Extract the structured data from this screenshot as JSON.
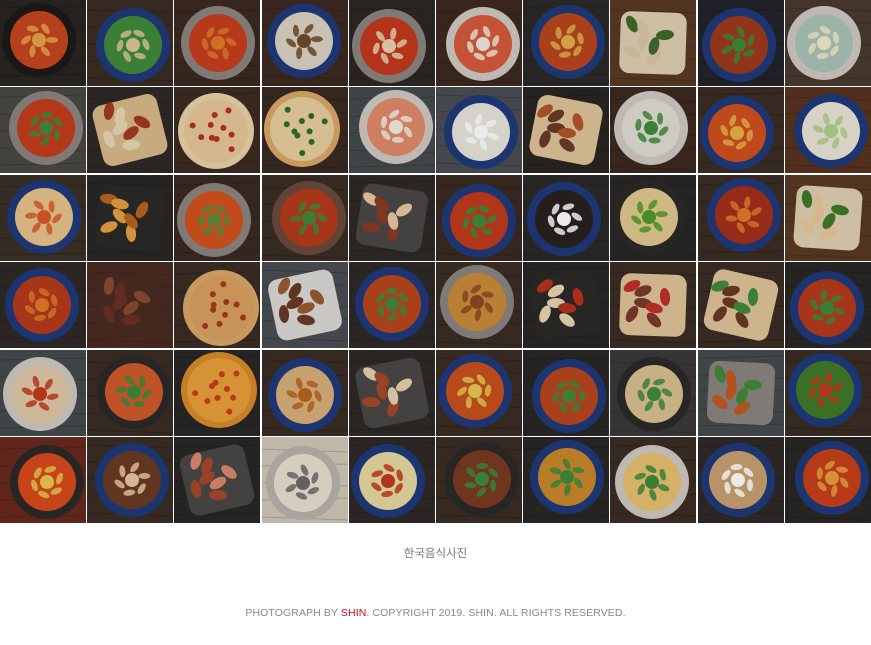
{
  "gallery": {
    "columns": 10,
    "rows": 6,
    "tiles": [
      {
        "bg": "#2a2522",
        "plate": "#1d1b1a",
        "food": "#c7461f",
        "accent": "#e8a34a",
        "shape": "bowl"
      },
      {
        "bg": "#3a2d24",
        "plate": "#1f3a7a",
        "food": "#3f8a3a",
        "accent": "#d9c69b",
        "shape": "bowl"
      },
      {
        "bg": "#3b2a20",
        "plate": "#8a8580",
        "food": "#c63e1e",
        "accent": "#e07a2a",
        "shape": "bowl"
      },
      {
        "bg": "#3d2b22",
        "plate": "#1f3a7a",
        "food": "#d9d2c4",
        "accent": "#6b4a2a",
        "shape": "bowl"
      },
      {
        "bg": "#2e2824",
        "plate": "#8a8580",
        "food": "#c4381e",
        "accent": "#e7d3b0",
        "shape": "bowl"
      },
      {
        "bg": "#3d2a20",
        "plate": "#cfc9c2",
        "food": "#d55a3c",
        "accent": "#f0e8dc",
        "shape": "bowl"
      },
      {
        "bg": "#2c2a28",
        "plate": "#1f3a7a",
        "food": "#b8461e",
        "accent": "#e3b04a",
        "shape": "bowl"
      },
      {
        "bg": "#5a3a24",
        "plate": "#e0cfb2",
        "food": "#d8c7a4",
        "accent": "#3f6b2a",
        "shape": "flat"
      },
      {
        "bg": "#23242a",
        "plate": "#1f3a7a",
        "food": "#9e3a1c",
        "accent": "#3f8a3a",
        "shape": "bowl"
      },
      {
        "bg": "#4a3a30",
        "plate": "#cfc9c2",
        "food": "#a9c4b6",
        "accent": "#f4e9c8",
        "shape": "bowl"
      },
      {
        "bg": "#4a4844",
        "plate": "#8a8580",
        "food": "#c53c1c",
        "accent": "#3f8a3a",
        "shape": "bowl"
      },
      {
        "bg": "#2f2a26",
        "plate": "#d9b98a",
        "food": "#e8d7b5",
        "accent": "#a23a1e",
        "shape": "flat"
      },
      {
        "bg": "#3d2b22",
        "plate": "#e8d2a8",
        "food": "#e7c79a",
        "accent": "#b8321c",
        "shape": "pizza"
      },
      {
        "bg": "#3a2a22",
        "plate": "#d9a868",
        "food": "#e9cf9e",
        "accent": "#2f6e2a",
        "shape": "pizza"
      },
      {
        "bg": "#454a4e",
        "plate": "#cfc9c2",
        "food": "#e08a6a",
        "accent": "#f1ebe3",
        "shape": "bowl"
      },
      {
        "bg": "#4a4e52",
        "plate": "#1f3a7a",
        "food": "#e8e4dc",
        "accent": "#ffffff",
        "shape": "bowl"
      },
      {
        "bg": "#2a2522",
        "plate": "#e0c49a",
        "food": "#6a3a26",
        "accent": "#b0562a",
        "shape": "flat"
      },
      {
        "bg": "#3d2a20",
        "plate": "#cfc9c2",
        "food": "#e0ddd4",
        "accent": "#3f8a3a",
        "shape": "bowl"
      },
      {
        "bg": "#3a2d24",
        "plate": "#1f3a7a",
        "food": "#d0501e",
        "accent": "#e7b04a",
        "shape": "bowl"
      },
      {
        "bg": "#5a3220",
        "plate": "#1f3a7a",
        "food": "#e9e4d6",
        "accent": "#b0d08a",
        "shape": "bowl"
      },
      {
        "bg": "#3a3028",
        "plate": "#1f3a7a",
        "food": "#e8c38a",
        "accent": "#d65a2a",
        "shape": "bowl"
      },
      {
        "bg": "#2a2826",
        "plate": "#2b2a28",
        "food": "#e3a040",
        "accent": "#b8641e",
        "shape": "flat"
      },
      {
        "bg": "#3a2a22",
        "plate": "#8a8580",
        "food": "#d3521e",
        "accent": "#5e8a3a",
        "shape": "bowl"
      },
      {
        "bg": "#3a2d24",
        "plate": "#6a4a3a",
        "food": "#b63a1c",
        "accent": "#3f8a3a",
        "shape": "bowl"
      },
      {
        "bg": "#2f2a26",
        "plate": "#4a4846",
        "food": "#8a3a22",
        "accent": "#e8c8a0",
        "shape": "flat"
      },
      {
        "bg": "#3a2a22",
        "plate": "#1f3a7a",
        "food": "#c13a1c",
        "accent": "#3f8a3a",
        "shape": "bowl"
      },
      {
        "bg": "#2c2a28",
        "plate": "#1f3a7a",
        "food": "#2a2020",
        "accent": "#ffffff",
        "shape": "bowl"
      },
      {
        "bg": "#2a2826",
        "plate": "#2b2a28",
        "food": "#e0c890",
        "accent": "#4f9a2a",
        "shape": "bowl"
      },
      {
        "bg": "#3a2d24",
        "plate": "#1f3a7a",
        "food": "#a3301a",
        "accent": "#e07a2a",
        "shape": "bowl"
      },
      {
        "bg": "#5a3a24",
        "plate": "#e0cfb2",
        "food": "#e8c898",
        "accent": "#3f7a2a",
        "shape": "flat"
      },
      {
        "bg": "#2f2a26",
        "plate": "#1f3a7a",
        "food": "#b63a1c",
        "accent": "#e07a2a",
        "shape": "bowl"
      },
      {
        "bg": "#4a2c22",
        "plate": "#4a2c22",
        "food": "#6a3022",
        "accent": "#8a4a30",
        "shape": "flat"
      },
      {
        "bg": "#3a2d24",
        "plate": "#d9a868",
        "food": "#d8a060",
        "accent": "#a83a1c",
        "shape": "pizza"
      },
      {
        "bg": "#4a4e52",
        "plate": "#dcdad6",
        "food": "#6a3a26",
        "accent": "#9a5a34",
        "shape": "flat"
      },
      {
        "bg": "#2f2a26",
        "plate": "#1f3a7a",
        "food": "#b8461e",
        "accent": "#3f8a3a",
        "shape": "bowl"
      },
      {
        "bg": "#3a2d24",
        "plate": "#8a8580",
        "food": "#c88a3a",
        "accent": "#8a4a22",
        "shape": "bowl"
      },
      {
        "bg": "#2a2826",
        "plate": "#2b2a28",
        "food": "#e8d4b0",
        "accent": "#b8321c",
        "shape": "flat"
      },
      {
        "bg": "#3a2d24",
        "plate": "#e0c49a",
        "food": "#7a3a2a",
        "accent": "#c0302a",
        "shape": "flat"
      },
      {
        "bg": "#3a2d24",
        "plate": "#e0c49a",
        "food": "#6a3a22",
        "accent": "#3f8a3a",
        "shape": "flat"
      },
      {
        "bg": "#2a2826",
        "plate": "#1f3a7a",
        "food": "#b63a1c",
        "accent": "#3f8a3a",
        "shape": "bowl"
      },
      {
        "bg": "#454a4e",
        "plate": "#cfc9c2",
        "food": "#e0c8a8",
        "accent": "#c13a1c",
        "shape": "bowl"
      },
      {
        "bg": "#3a2d24",
        "plate": "#2b2a28",
        "food": "#d05a2a",
        "accent": "#3f8a3a",
        "shape": "bowl"
      },
      {
        "bg": "#2a2826",
        "plate": "#d88a2a",
        "food": "#e8a03a",
        "accent": "#c8401c",
        "shape": "pizza"
      },
      {
        "bg": "#3a2d24",
        "plate": "#1f3a7a",
        "food": "#d8b07a",
        "accent": "#b8641e",
        "shape": "bowl"
      },
      {
        "bg": "#2f2a26",
        "plate": "#4a4846",
        "food": "#a8482a",
        "accent": "#e8d0b0",
        "shape": "flat"
      },
      {
        "bg": "#3a2d24",
        "plate": "#1f3a7a",
        "food": "#c8501e",
        "accent": "#e8c850",
        "shape": "bowl"
      },
      {
        "bg": "#2a2826",
        "plate": "#1f3a7a",
        "food": "#b8461e",
        "accent": "#3f8a3a",
        "shape": "bowl"
      },
      {
        "bg": "#3a3a3a",
        "plate": "#2b2a28",
        "food": "#d8c090",
        "accent": "#3f8a3a",
        "shape": "bowl"
      },
      {
        "bg": "#454a4e",
        "plate": "#8a8580",
        "food": "#c05a22",
        "accent": "#3f8a3a",
        "shape": "flat"
      },
      {
        "bg": "#3a2d24",
        "plate": "#1f3a7a",
        "food": "#3f7a2a",
        "accent": "#c13a1c",
        "shape": "bowl"
      },
      {
        "bg": "#6a2a1e",
        "plate": "#2b2a28",
        "food": "#d84a1e",
        "accent": "#e8c850",
        "shape": "bowl"
      },
      {
        "bg": "#3a2d24",
        "plate": "#1f3a7a",
        "food": "#6a3a22",
        "accent": "#e8c8a0",
        "shape": "bowl"
      },
      {
        "bg": "#2a2826",
        "plate": "#4a4846",
        "food": "#a8482a",
        "accent": "#d88a6a",
        "shape": "flat"
      },
      {
        "bg": "#d0c8b8",
        "plate": "#b8b4ac",
        "food": "#e8e0d0",
        "accent": "#6a6a6a",
        "shape": "bowl"
      },
      {
        "bg": "#2f2a26",
        "plate": "#1f3a7a",
        "food": "#e8d8a0",
        "accent": "#c13a1c",
        "shape": "bowl"
      },
      {
        "bg": "#3a2d24",
        "plate": "#2b2a28",
        "food": "#7a3a22",
        "accent": "#3f8a3a",
        "shape": "bowl"
      },
      {
        "bg": "#2a2826",
        "plate": "#1f3a7a",
        "food": "#c8882a",
        "accent": "#3f8a3a",
        "shape": "bowl"
      },
      {
        "bg": "#3a2d24",
        "plate": "#cfc9c2",
        "food": "#e8c070",
        "accent": "#3f8a3a",
        "shape": "bowl"
      },
      {
        "bg": "#2f2a26",
        "plate": "#1f3a7a",
        "food": "#c8a070",
        "accent": "#ffffff",
        "shape": "bowl"
      },
      {
        "bg": "#2a2826",
        "plate": "#1f3a7a",
        "food": "#c8401c",
        "accent": "#e8a040",
        "shape": "bowl"
      }
    ]
  },
  "caption": "한국음식사진",
  "footer": {
    "prefix": "PHOTOGRAPH BY ",
    "author": "SHIN",
    "suffix": ". COPYRIGHT 2019. SHIN. ALL RIGHTS RESERVED."
  }
}
